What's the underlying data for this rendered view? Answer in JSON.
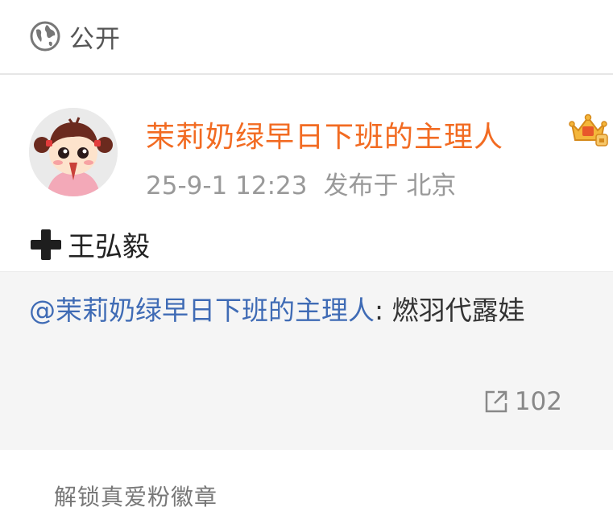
{
  "visibility": {
    "icon": "globe-icon",
    "label": "公开"
  },
  "post": {
    "author": {
      "name": "茉莉奶绿早日下班的主理人",
      "name_color": "#f26b22",
      "badge_icon": "vip-crown-icon"
    },
    "timestamp": "25-9-1 12:23",
    "location": "发布于 北京",
    "text": "王弘毅",
    "text_icon": "plus-icon"
  },
  "repost": {
    "mention": "@茉莉奶绿早日下班的主理人",
    "content": ": 燃羽代露娃",
    "mention_color": "#3f6bb5",
    "count_icon": "share-icon",
    "count": "102"
  },
  "footer": {
    "fan_badge_label": "解锁真爱粉徽章"
  }
}
